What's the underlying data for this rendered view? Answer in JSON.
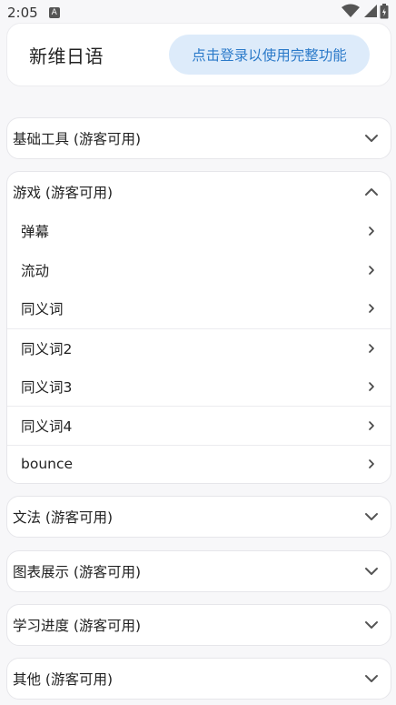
{
  "status_bar": {
    "time": "2:05",
    "notification_icon_text": "A",
    "icons": [
      "wifi-icon",
      "signal-icon",
      "battery-icon"
    ]
  },
  "header": {
    "title": "新维日语",
    "login_button": "点击登录以使用完整功能"
  },
  "sections": [
    {
      "title": "基础工具 (游客可用)",
      "expanded": false
    },
    {
      "title": "游戏 (游客可用)",
      "expanded": true,
      "items": [
        "弹幕",
        "流动",
        "同义词",
        "同义词2",
        "同义词3",
        "同义词4",
        "bounce"
      ]
    },
    {
      "title": "文法 (游客可用)",
      "expanded": false
    },
    {
      "title": "图表展示 (游客可用)",
      "expanded": false
    },
    {
      "title": "学习进度 (游客可用)",
      "expanded": false
    },
    {
      "title": "其他 (游客可用)",
      "expanded": false
    }
  ],
  "colors": {
    "background": "#f7f7f9",
    "login_button_bg": "#ddebfa",
    "login_button_text": "#2b7ac9"
  }
}
